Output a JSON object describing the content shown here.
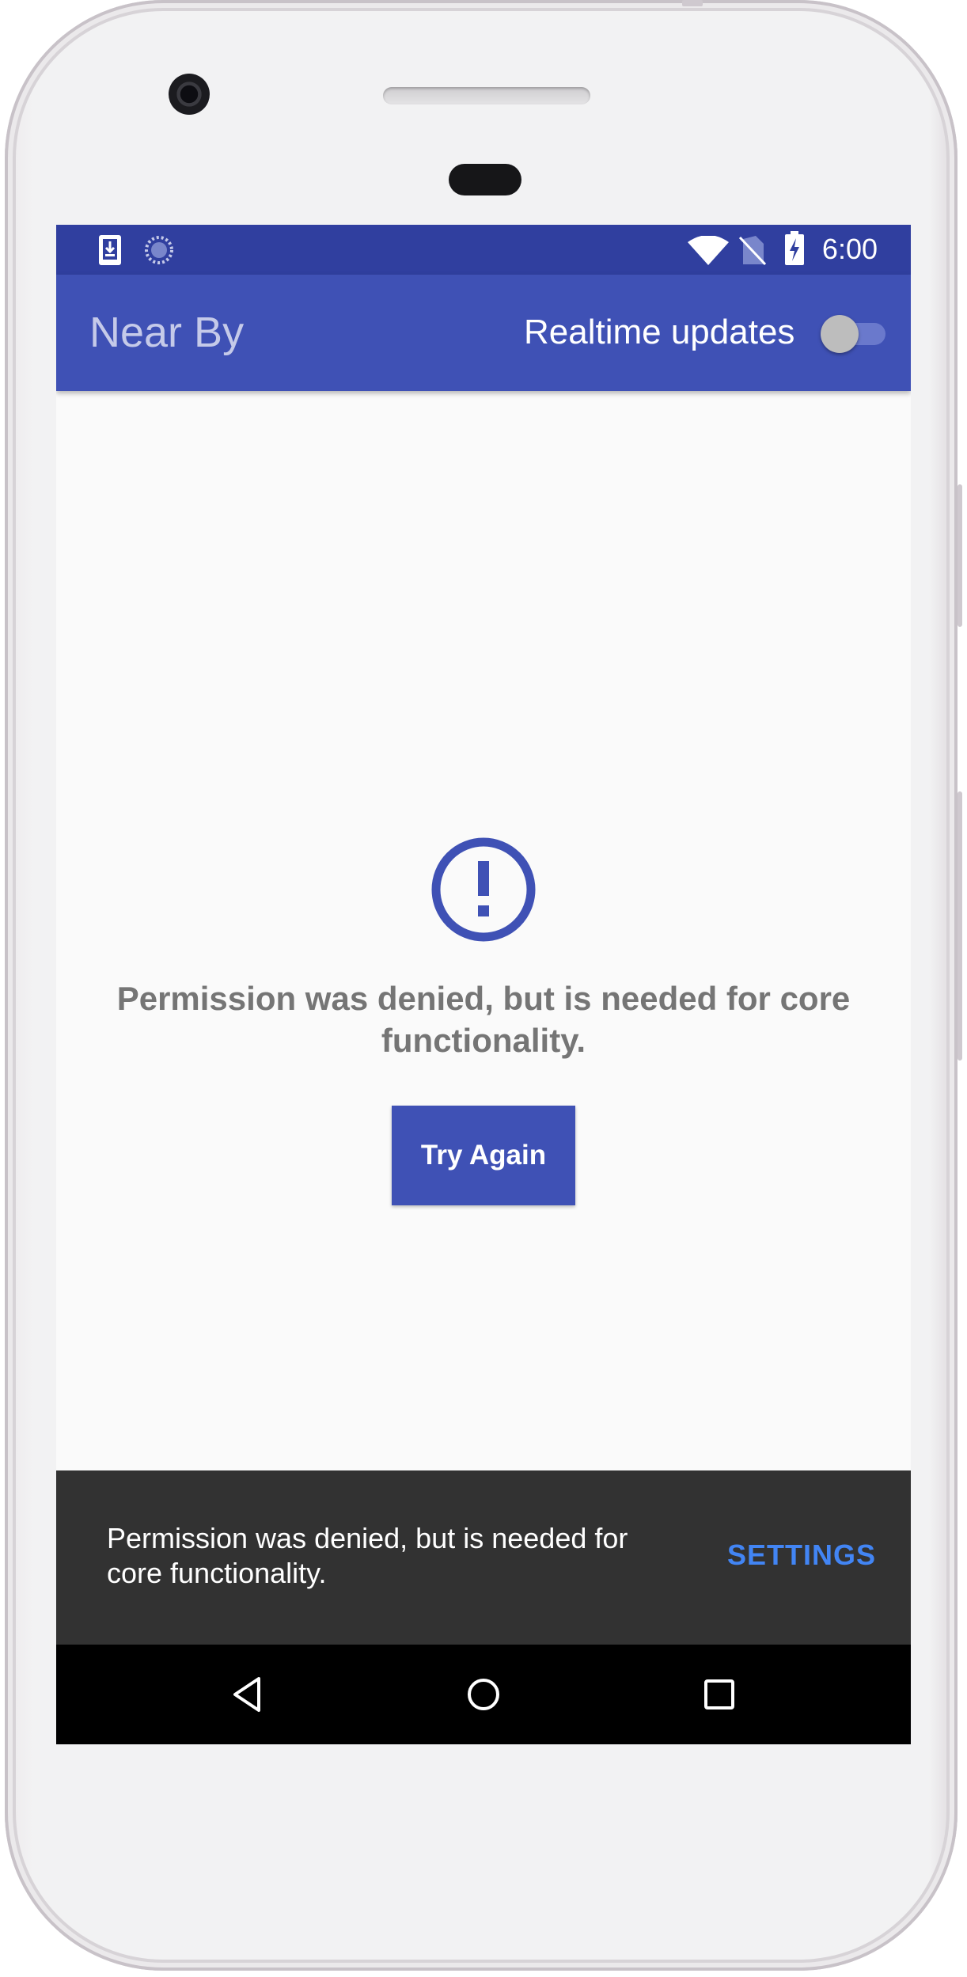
{
  "status_bar": {
    "time": "6:00",
    "left_icons": [
      "download-notification-icon",
      "sync-icon"
    ],
    "right_icons": [
      "wifi-icon",
      "no-sim-icon",
      "battery-charging-icon"
    ]
  },
  "app_bar": {
    "title": "Near By",
    "realtime_label": "Realtime updates",
    "realtime_enabled": false
  },
  "content": {
    "icon": "error-icon",
    "message": "Permission was denied, but is needed for core functionality.",
    "try_again_label": "Try Again"
  },
  "snackbar": {
    "message": "Permission was denied, but is needed for core functionality.",
    "action_label": "SETTINGS"
  },
  "nav_bar": {
    "buttons": [
      "back-icon",
      "home-icon",
      "recents-icon"
    ]
  },
  "colors": {
    "primary": "#3f51b5",
    "primary_dark": "#303f9f",
    "snackbar_bg": "#323232",
    "snackbar_action": "#4285f4",
    "message_text": "#757575"
  }
}
